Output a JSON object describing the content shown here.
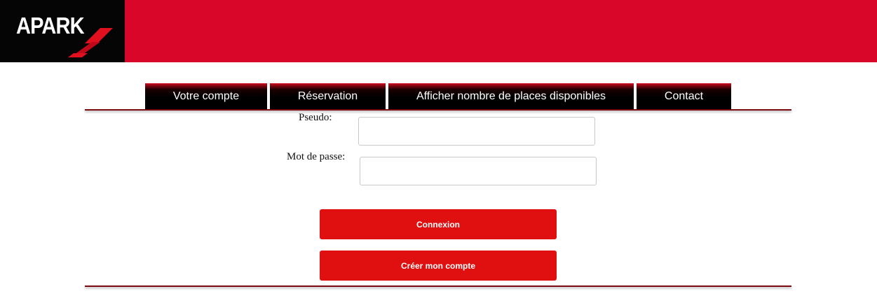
{
  "header": {
    "logo_text": "APARK",
    "brand_color": "#d9062a"
  },
  "nav": {
    "items": [
      {
        "label": "Votre compte"
      },
      {
        "label": "Réservation"
      },
      {
        "label": "Afficher nombre de places disponibles"
      },
      {
        "label": "Contact"
      }
    ]
  },
  "login_form": {
    "pseudo_label": "Pseudo:",
    "pseudo_value": "",
    "password_label": "Mot de passe:",
    "password_value": "",
    "connexion_button": "Connexion",
    "create_account_button": "Créer mon compte",
    "button_color": "#e01010"
  },
  "icons": {
    "logo": "apark-logo",
    "logo_mark": "red-chevron-swoosh"
  }
}
